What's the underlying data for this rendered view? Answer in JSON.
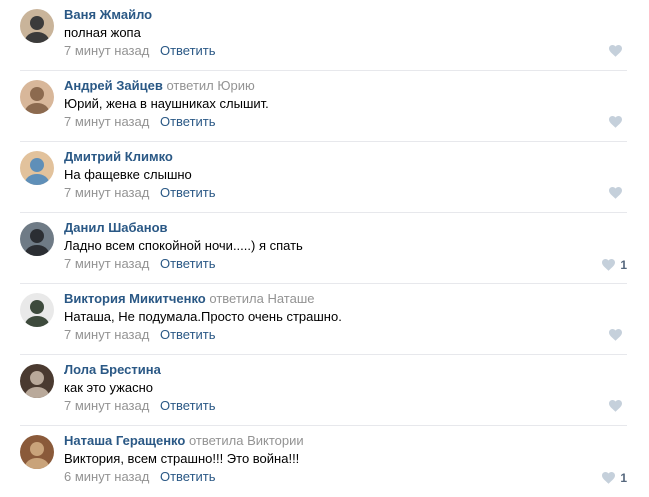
{
  "comments": [
    {
      "author": "Ваня Жмайло",
      "reply_to": "",
      "text": "полная жопа",
      "time": "7 минут назад",
      "reply_label": "Ответить",
      "likes": "",
      "avatar_colors": [
        "#3b3b3b",
        "#c9b49a"
      ]
    },
    {
      "author": "Андрей Зайцев",
      "reply_to": "ответил Юрию",
      "text": "Юрий, жена в наушниках слышит.",
      "time": "7 минут назад",
      "reply_label": "Ответить",
      "likes": "",
      "avatar_colors": [
        "#8c6a4f",
        "#d8b79a"
      ]
    },
    {
      "author": "Дмитрий Климко",
      "reply_to": "",
      "text": "На фащевке слышно",
      "time": "7 минут назад",
      "reply_label": "Ответить",
      "likes": "",
      "avatar_colors": [
        "#5f8fb8",
        "#e2c29c"
      ]
    },
    {
      "author": "Данил Шабанов",
      "reply_to": "",
      "text": "Ладно всем спокойной ночи.....) я спать",
      "time": "7 минут назад",
      "reply_label": "Ответить",
      "likes": "1",
      "avatar_colors": [
        "#2b2e33",
        "#6f7b86"
      ]
    },
    {
      "author": "Виктория Микитченко",
      "reply_to": "ответила Наташе",
      "text": "Наташа, Не подумала.Просто очень страшно.",
      "time": "7 минут назад",
      "reply_label": "Ответить",
      "likes": "",
      "avatar_colors": [
        "#3d4a3c",
        "#e9e9e9"
      ]
    },
    {
      "author": "Лола Брестина",
      "reply_to": "",
      "text": "как это ужасно",
      "time": "7 минут назад",
      "reply_label": "Ответить",
      "likes": "",
      "avatar_colors": [
        "#b9a99a",
        "#4a3a30"
      ]
    },
    {
      "author": "Наташа Геращенко",
      "reply_to": "ответила Виктории",
      "text": "Виктория, всем страшно!!! Это война!!!",
      "time": "6 минут назад",
      "reply_label": "Ответить",
      "likes": "1",
      "avatar_colors": [
        "#c9a37a",
        "#8a5a3a"
      ]
    }
  ],
  "colors": {
    "author": "#2a5885",
    "muted": "#939393",
    "like_icon": "#c5d0db",
    "like_count": "#55677d",
    "divider": "#e7e8ec"
  }
}
